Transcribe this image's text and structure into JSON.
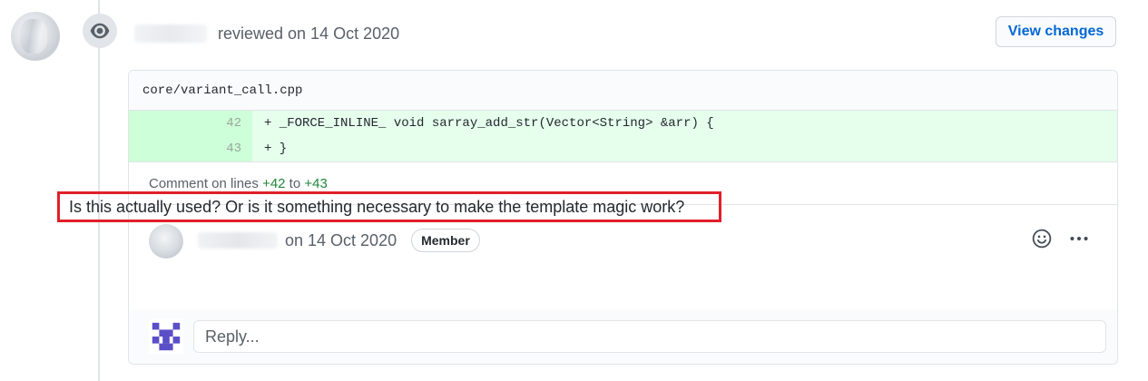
{
  "review": {
    "action_text": "reviewed on 14 Oct 2020",
    "view_changes_label": "View changes"
  },
  "thread": {
    "file_path": "core/variant_call.cpp",
    "diff_lines": [
      {
        "number": "42",
        "code": "+ _FORCE_INLINE_ void sarray_add_str(Vector<String> &arr) {"
      },
      {
        "number": "43",
        "code": "+ }"
      }
    ],
    "comment_on": {
      "prefix": "Comment on lines ",
      "start": "+42",
      "middle": " to ",
      "end": "+43"
    }
  },
  "comment": {
    "date_text": "on 14 Oct 2020",
    "role_badge": "Member",
    "body": "Is this actually used? Or is it something necessary to make the template magic work?"
  },
  "reply": {
    "placeholder": "Reply..."
  },
  "icons": {
    "eye": "eye-icon",
    "smiley": "smiley-icon",
    "kebab": "kebab-horizontal-icon"
  },
  "colors": {
    "link": "#0366d6",
    "added_bg": "#e6ffed",
    "added_num_bg": "#cdffd8",
    "highlight_border": "#e0202a"
  }
}
